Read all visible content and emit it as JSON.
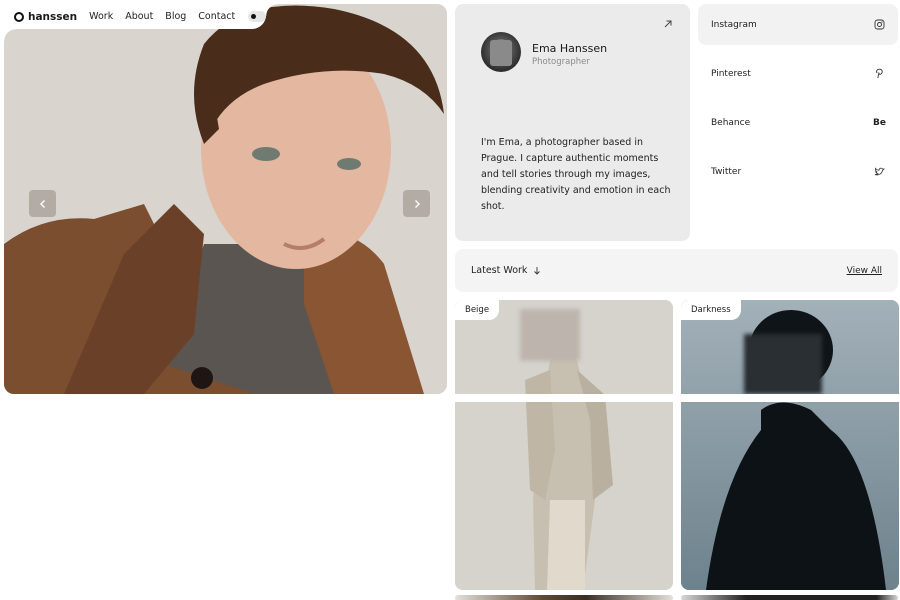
{
  "nav": {
    "brand": "hanssen",
    "links": [
      "Work",
      "About",
      "Blog",
      "Contact"
    ]
  },
  "hero": {
    "prev_icon": "chevron-left-icon",
    "next_icon": "chevron-right-icon"
  },
  "profile": {
    "name": "Ema Hanssen",
    "role": "Photographer",
    "bio": "I'm Ema, a photographer based in Prague. I capture authentic moments and tell stories through my images, blending creativity and emotion in each shot.",
    "link_icon": "arrow-up-right-icon"
  },
  "socials": [
    {
      "label": "Instagram",
      "icon": "instagram-icon"
    },
    {
      "label": "Pinterest",
      "icon": "pinterest-icon"
    },
    {
      "label": "Behance",
      "icon": "behance-icon",
      "glyph": "Be"
    },
    {
      "label": "Twitter",
      "icon": "twitter-icon"
    }
  ],
  "latest_work": {
    "label": "Latest Work",
    "view_all": "View All"
  },
  "cards": [
    {
      "tag": "Beige"
    },
    {
      "tag": "Darkness"
    }
  ],
  "colors": {
    "panel": "#ebebeb",
    "panel_light": "#f4f4f4",
    "text": "#1a1a1a",
    "muted": "#8b8b8b"
  }
}
